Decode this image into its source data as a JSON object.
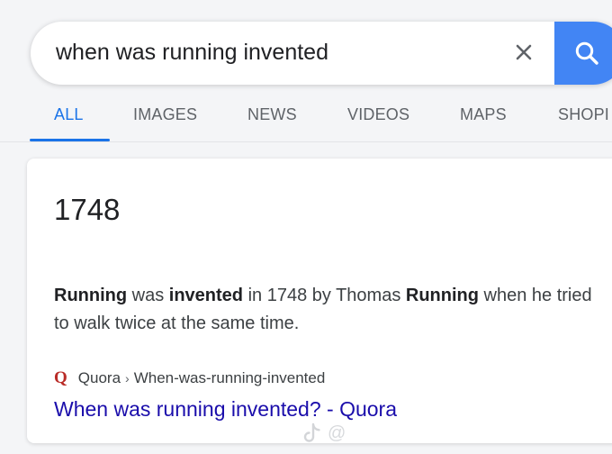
{
  "search": {
    "query": "when was running invented",
    "clear_icon": "close-icon",
    "submit_icon": "search-icon"
  },
  "tabs": [
    {
      "label": "ALL",
      "active": true
    },
    {
      "label": "IMAGES",
      "active": false
    },
    {
      "label": "NEWS",
      "active": false
    },
    {
      "label": "VIDEOS",
      "active": false
    },
    {
      "label": "MAPS",
      "active": false
    },
    {
      "label": "SHOPI",
      "active": false
    }
  ],
  "result": {
    "answer": "1748",
    "snippet": {
      "t1": "Running",
      "t2": " was ",
      "t3": "invented",
      "t4": " in 1748 by Thomas ",
      "t5": "Running",
      "t6": " when he tried to walk twice at the same time."
    },
    "source_logo": "Q",
    "source_name": "Quora",
    "source_separator": "›",
    "source_path": "When-was-running-invented",
    "link_title": "When was running invented? - Quora"
  },
  "watermark": {
    "icon": "tiktok-icon",
    "text": "@"
  },
  "colors": {
    "accent": "#1a73e8",
    "search_button": "#4285f4",
    "link": "#1a0dab",
    "quora": "#b92b27",
    "background": "#f4f5f7"
  }
}
